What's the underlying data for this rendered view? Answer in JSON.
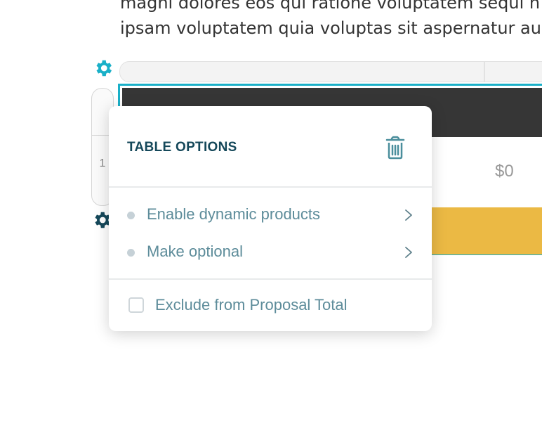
{
  "document": {
    "paragraph_lines": [
      "magni dolores eos qui ratione voluptatem sequi n",
      "ipsam voluptatem quia voluptas sit aspernatur au"
    ]
  },
  "table": {
    "row_number": "1",
    "price_value": "$0",
    "colors": {
      "header": "#363636",
      "total_row": "#ebb944",
      "selection_border": "#1ab0c8"
    }
  },
  "popover": {
    "title": "TABLE OPTIONS",
    "items": [
      {
        "label": "Enable dynamic products",
        "icon": "chevron-right-icon"
      },
      {
        "label": "Make optional",
        "icon": "chevron-right-icon"
      }
    ],
    "exclude_label": "Exclude from Proposal Total",
    "exclude_checked": false,
    "delete_icon": "trash-icon"
  },
  "icons": {
    "table_settings": "gear-icon",
    "row_settings": "gear-icon"
  }
}
